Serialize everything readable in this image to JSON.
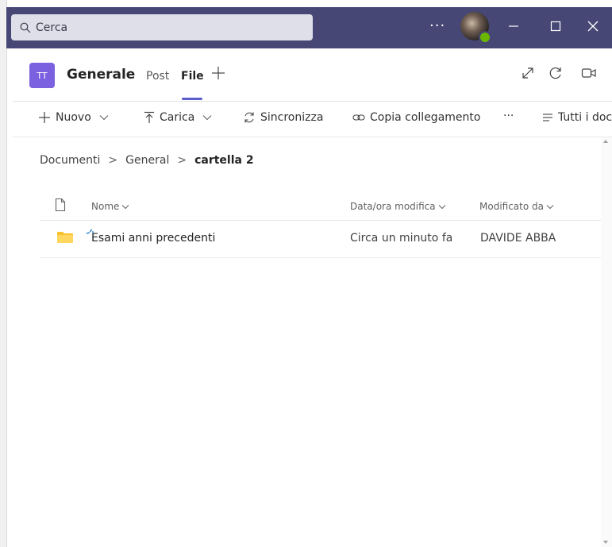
{
  "titlebar": {
    "search_placeholder": "Cerca",
    "more_label": "···",
    "bg_color": "#464775"
  },
  "header": {
    "team_initials": "TT",
    "channel_name": "Generale",
    "tabs": [
      {
        "label": "Post",
        "active": false
      },
      {
        "label": "File",
        "active": true
      }
    ],
    "accent_color": "#5b5fc7"
  },
  "toolbar": {
    "new_label": "Nuovo",
    "upload_label": "Carica",
    "sync_label": "Sincronizza",
    "copy_link_label": "Copia collegamento",
    "more_label": "···",
    "view_label": "Tutti i doc"
  },
  "breadcrumb": {
    "items": [
      "Documenti",
      "General"
    ],
    "current": "cartella 2"
  },
  "table": {
    "columns": {
      "name": "Nome",
      "modified": "Data/ora modifica",
      "modified_by": "Modificato da"
    },
    "rows": [
      {
        "name": "Esami anni precedenti",
        "modified": "Circa un minuto fa",
        "modified_by": "DAVIDE ABBA",
        "type": "folder"
      }
    ]
  }
}
